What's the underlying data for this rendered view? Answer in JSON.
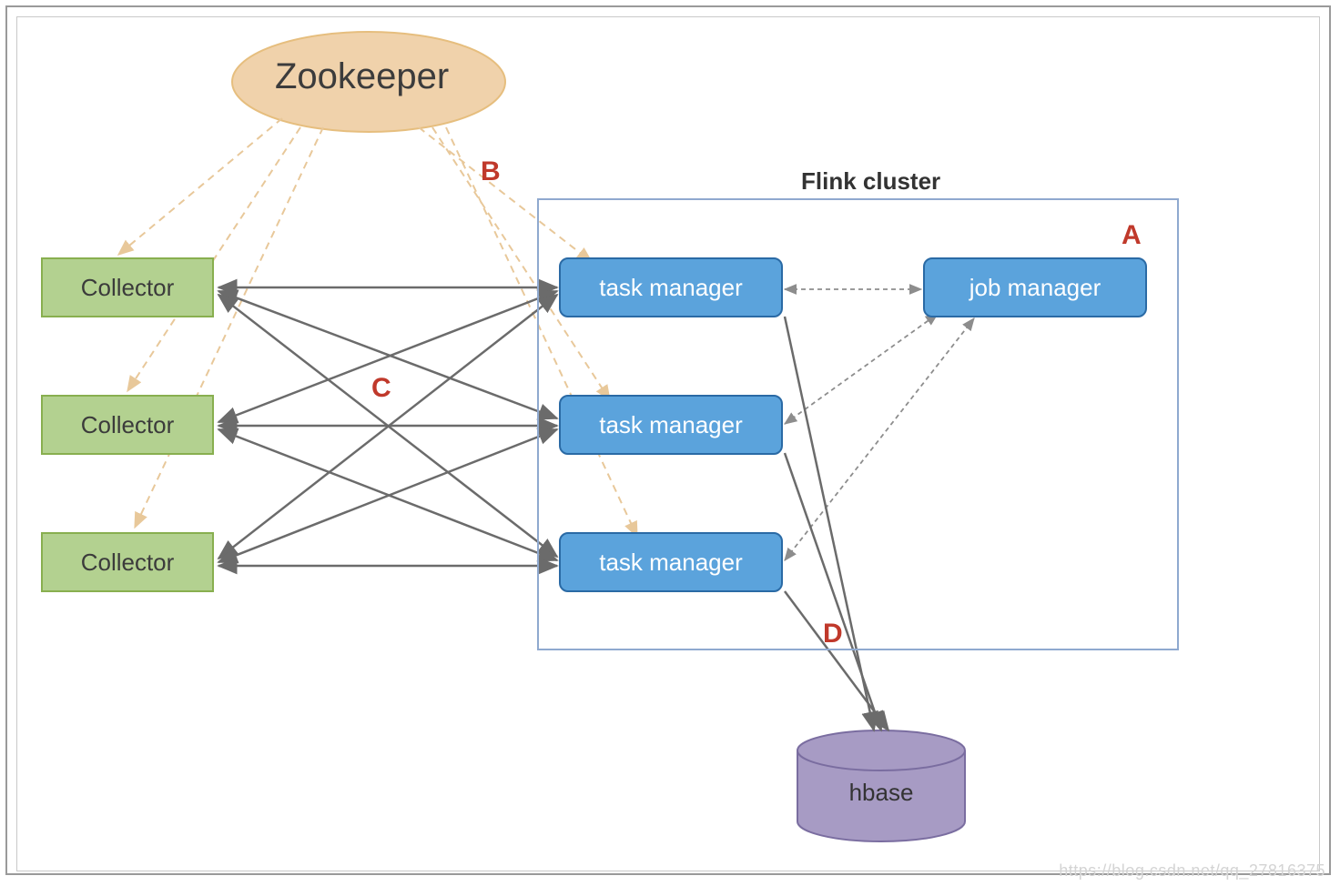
{
  "nodes": {
    "zookeeper": "Zookeeper",
    "collector1": "Collector",
    "collector2": "Collector",
    "collector3": "Collector",
    "task1": "task manager",
    "task2": "task manager",
    "task3": "task manager",
    "jobmgr": "job manager",
    "hbase": "hbase"
  },
  "cluster_label": "Flink cluster",
  "annotations": {
    "A": "A",
    "B": "B",
    "C": "C",
    "D": "D"
  },
  "watermark": "https://blog.csdn.net/qq_27816375",
  "colors": {
    "collector_fill": "#b3d190",
    "task_fill": "#5ba3dc",
    "zookeeper_fill": "#f0d2ab",
    "hbase_fill": "#a79bc4",
    "annotation": "#c0392b"
  }
}
